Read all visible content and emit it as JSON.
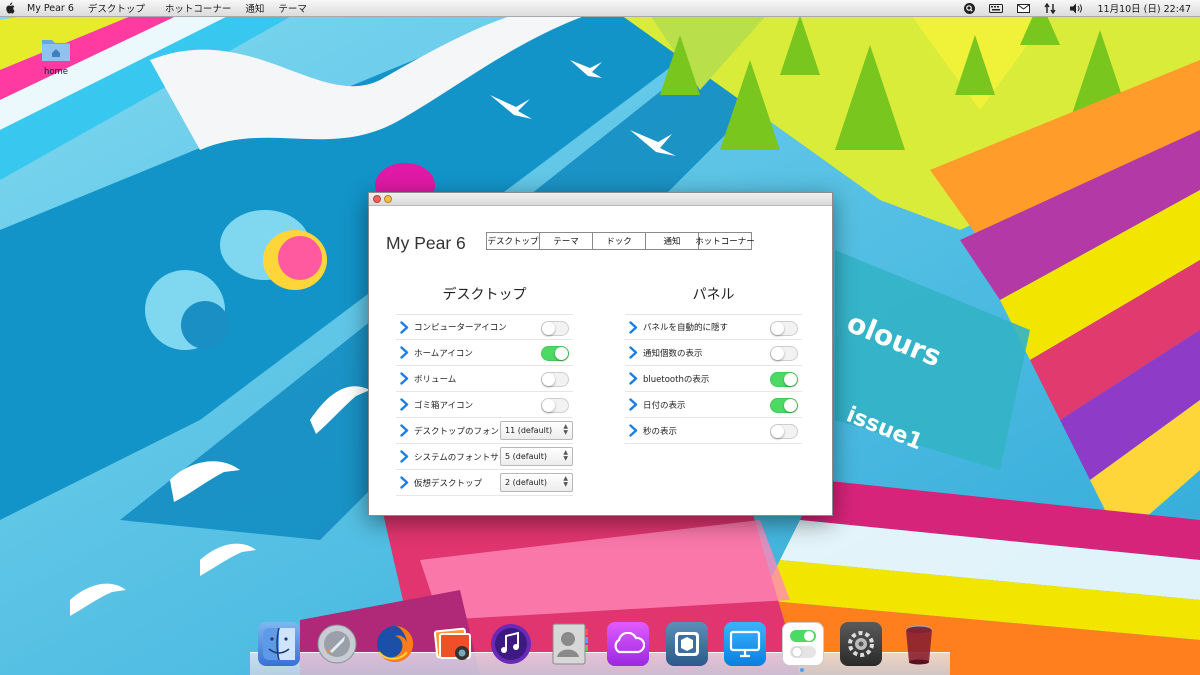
{
  "menubar": {
    "app_name": "My Pear 6",
    "menus": [
      "デスクトップ",
      "ホットコーナー",
      "通知",
      "テーマ"
    ],
    "clock": "11月10日 (日) 22:47",
    "status_icons": [
      "search-icon",
      "keyboard-icon",
      "mail-icon",
      "network-icon",
      "volume-icon"
    ]
  },
  "desktop": {
    "home_label": "home"
  },
  "window": {
    "title": "My Pear 6",
    "tabs": [
      "デスクトップ",
      "テーマ",
      "ドック",
      "通知",
      "ホットコーナー"
    ],
    "desktop_section": {
      "title": "デスクトップ",
      "items": [
        {
          "label": "コンピューターアイコン",
          "control": "toggle",
          "on": false
        },
        {
          "label": "ホームアイコン",
          "control": "toggle",
          "on": true
        },
        {
          "label": "ボリューム",
          "control": "toggle",
          "on": false
        },
        {
          "label": "ゴミ箱アイコン",
          "control": "toggle",
          "on": false
        },
        {
          "label": "デスクトップのフォント",
          "control": "select",
          "value": "11 (default)"
        },
        {
          "label": "システムのフォントサイズ",
          "control": "select",
          "value": "5 (default)"
        },
        {
          "label": "仮想デスクトップ",
          "control": "select",
          "value": "2 (default)"
        }
      ]
    },
    "panel_section": {
      "title": "パネル",
      "items": [
        {
          "label": "パネルを自動的に隠す",
          "control": "toggle",
          "on": false
        },
        {
          "label": "通知個数の表示",
          "control": "toggle",
          "on": false
        },
        {
          "label": "bluetoothの表示",
          "control": "toggle",
          "on": true
        },
        {
          "label": "日付の表示",
          "control": "toggle",
          "on": true
        },
        {
          "label": "秒の表示",
          "control": "toggle",
          "on": false
        }
      ]
    }
  },
  "dock": {
    "items": [
      "finder-icon",
      "rocket-launcher-icon",
      "firefox-icon",
      "photos-icon",
      "music-icon",
      "contacts-icon",
      "cloud-icon",
      "cydia-box-icon",
      "display-icon",
      "toggle-settings-icon",
      "system-settings-icon",
      "trash-icon"
    ]
  },
  "colors": {
    "accent": "#1a7fe6",
    "toggle_on": "#4cd964",
    "wallpaper_sky": "#5cc6e0",
    "wallpaper_magenta": "#d6247a",
    "wallpaper_yellow": "#f2e600"
  }
}
